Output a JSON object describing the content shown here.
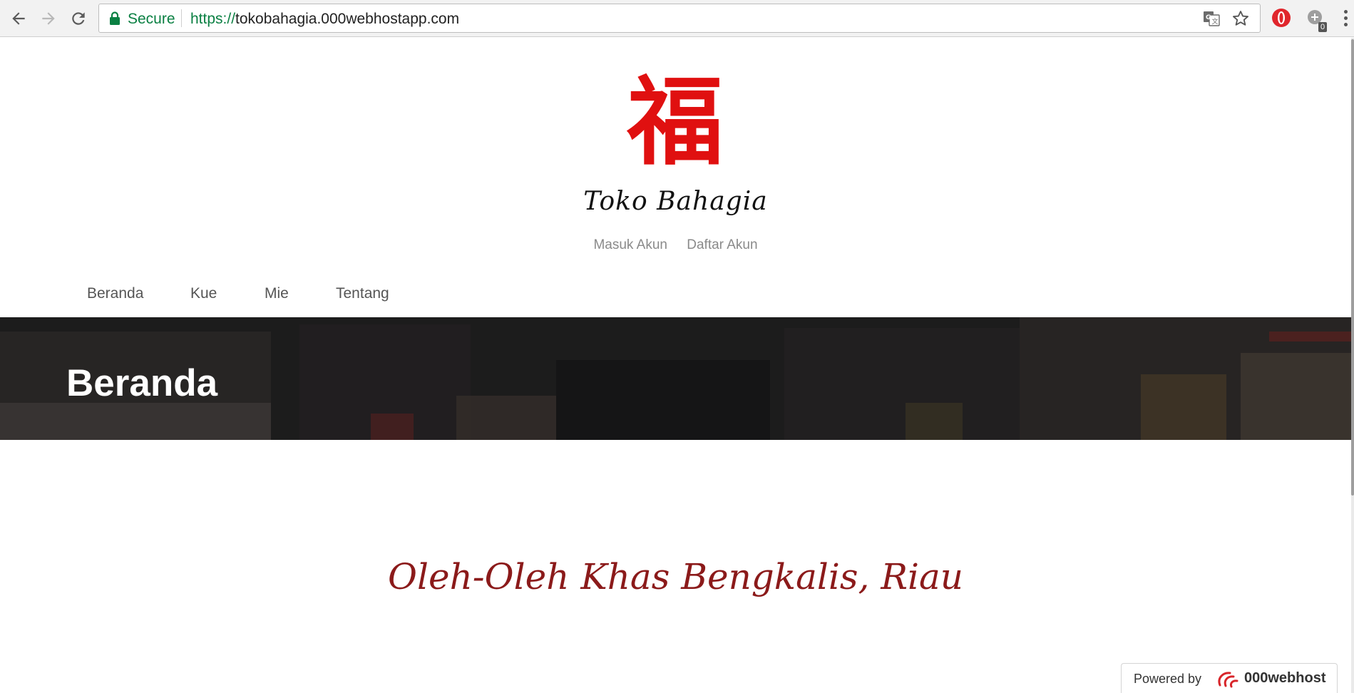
{
  "browser": {
    "secure_label": "Secure",
    "url_scheme": "https://",
    "url_host": "tokobahagia.000webhostapp.com",
    "extension_badge": "0",
    "icons": [
      "back-icon",
      "forward-icon",
      "reload-icon",
      "lock-icon",
      "translate-icon",
      "star-icon",
      "opera-icon",
      "extension-icon",
      "menu-icon"
    ]
  },
  "site": {
    "logo_glyph": "福",
    "name": "Toko Bahagia",
    "account_links": [
      "Masuk Akun",
      "Daftar Akun"
    ],
    "nav": [
      "Beranda",
      "Kue",
      "Mie",
      "Tentang"
    ]
  },
  "banner": {
    "title": "Beranda"
  },
  "main": {
    "tagline": "Oleh-Oleh Khas Bengkalis, Riau"
  },
  "footer_badge": {
    "powered_by": "Powered by",
    "brand": "000webhost"
  },
  "colors": {
    "secure_green": "#0b8043",
    "logo_red": "#e01010",
    "tagline_red": "#8b1a1a",
    "banner_dark": "#2b2b2b"
  }
}
